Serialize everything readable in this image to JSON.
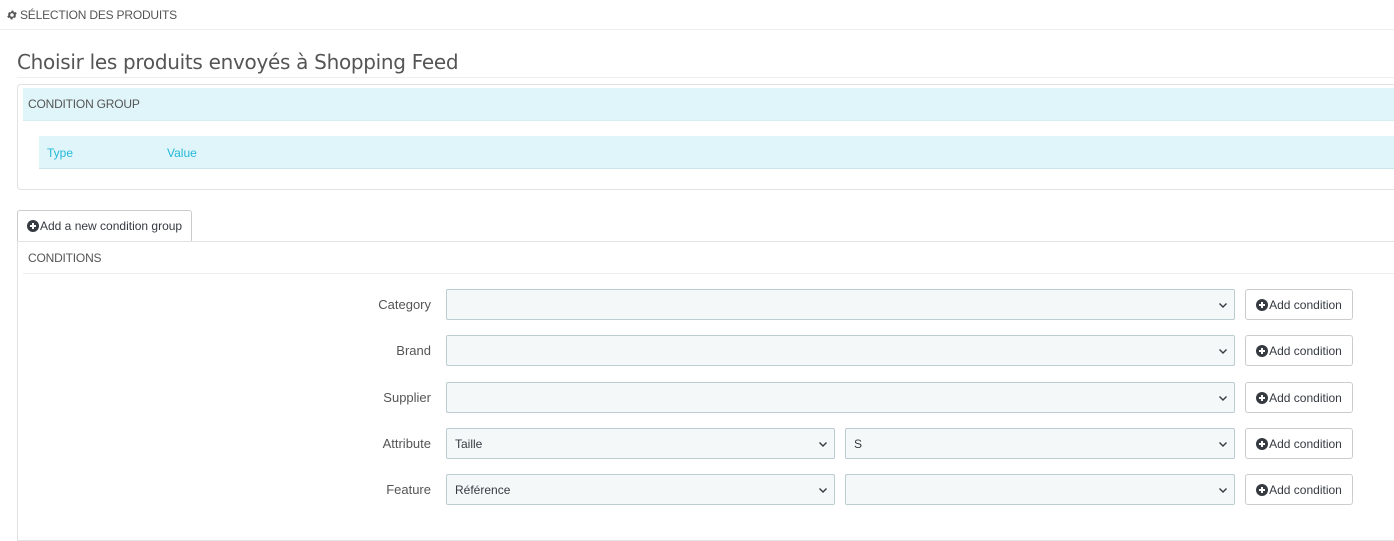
{
  "section": {
    "title": "SÉLECTION DES PRODUITS",
    "icon": "gear-icon"
  },
  "page_title": "Choisir les produits envoyés à Shopping Feed",
  "condition_group": {
    "header": "CONDITION GROUP",
    "columns": [
      "Type",
      "Value"
    ]
  },
  "add_group_button": {
    "label": "Add a new condition group",
    "icon": "plus-circle-icon"
  },
  "conditions": {
    "header": "CONDITIONS",
    "add_condition_label": "Add condition",
    "rows": [
      {
        "label": "Category",
        "select1": "",
        "select2": null
      },
      {
        "label": "Brand",
        "select1": "",
        "select2": null
      },
      {
        "label": "Supplier",
        "select1": "",
        "select2": null
      },
      {
        "label": "Attribute",
        "select1": "Taille",
        "select2": "S"
      },
      {
        "label": "Feature",
        "select1": "Référence",
        "select2": ""
      }
    ]
  },
  "colors": {
    "panel_head_bg": "#dff5f9",
    "column_header_text": "#25b9d7",
    "select_bg": "#f5f8f9",
    "select_border": "#bbcdd2"
  }
}
